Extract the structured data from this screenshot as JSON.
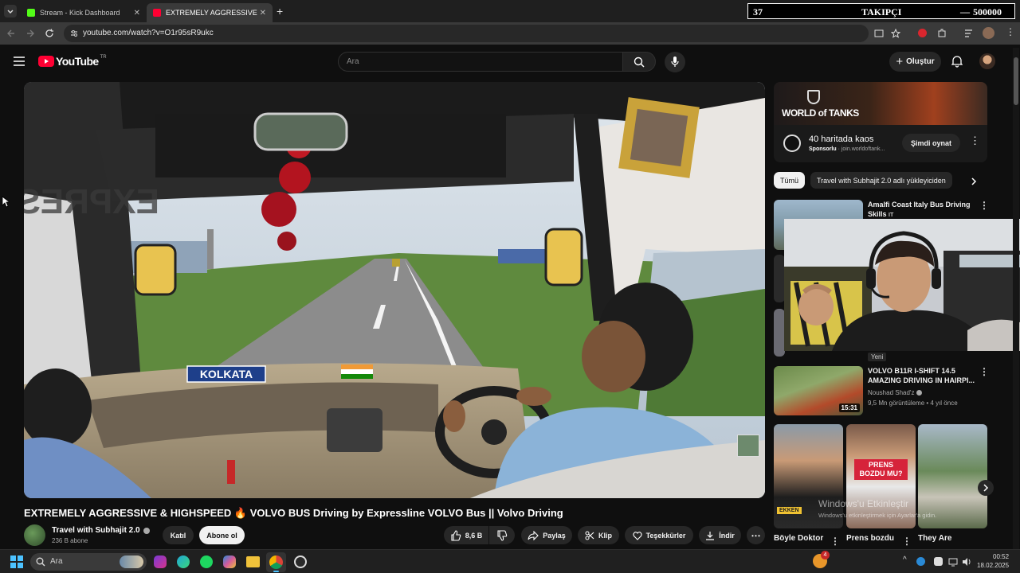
{
  "browser": {
    "tabs": [
      {
        "title": "Stream - Kick Dashboard",
        "favicon": "kick-icon",
        "color": "#53fc18"
      },
      {
        "title": "EXTREMELY AGGRESSIVE & HIG",
        "favicon": "youtube-icon",
        "color": "#ff0033"
      }
    ],
    "new_tab": "+",
    "url": "youtube.com/watch?v=O1r95sR9ukc"
  },
  "overlay_counter": {
    "count": "37",
    "label": "TAKIPÇI",
    "goal": "500000"
  },
  "youtube": {
    "logo_text": "YouTube",
    "region": "TR",
    "search_placeholder": "Ara",
    "create_label": "Oluştur"
  },
  "video": {
    "title": "EXTREMELY AGGRESSIVE & HIGHSPEED 🔥 VOLVO BUS Driving by Expressline VOLVO Bus || Volvo Driving",
    "sticker_text": "KOLKATA",
    "visor_text": "EXPRESS LINE",
    "channel": "Travel with Subhajit 2.0",
    "subscribers": "236 B abone",
    "join_label": "Katıl",
    "subscribe_label": "Abone ol",
    "likes": "8,6 B",
    "share_label": "Paylaş",
    "clip_label": "Klip",
    "thanks_label": "Teşekkürler",
    "download_label": "İndir"
  },
  "ad": {
    "brand": "WORLD of TANKS",
    "title": "40 haritada kaos",
    "sponsored": "Sponsorlu",
    "domain": "join.worldoftank...",
    "cta": "Şimdi oynat"
  },
  "chips": [
    "Tümü",
    "Travel with Subhajit 2.0 adlı yükleyiciden"
  ],
  "recommendations": [
    {
      "title": "Amalfi Coast Italy Bus Driving Skills",
      "suffix": "IT"
    },
    {
      "title": "VOLVO B11R I-SHIFT 14.5 AMAZING DRIVING IN HAIRPI...",
      "channel": "Noushad Shad'z",
      "meta": "9,5 Mn görüntüleme • 4 yıl önce",
      "duration": "15:31",
      "badge": "Yeni"
    }
  ],
  "shorts": [
    {
      "title": "Böyle Doktor",
      "thumb_text": "EKKEN"
    },
    {
      "title": "Prens bozdu",
      "thumb_text": "PRENS BOZDU MU?"
    },
    {
      "title": "They Are",
      "thumb_text": ""
    }
  ],
  "watermark": {
    "line1": "Windows'u Etkinleştir",
    "line2": "Windows'u etkinleştirmek için Ayarlar'a gidin."
  },
  "taskbar": {
    "search_placeholder": "Ara",
    "weather_badge": "4",
    "clock_time": "00:52",
    "clock_date": "18.02.2025"
  }
}
